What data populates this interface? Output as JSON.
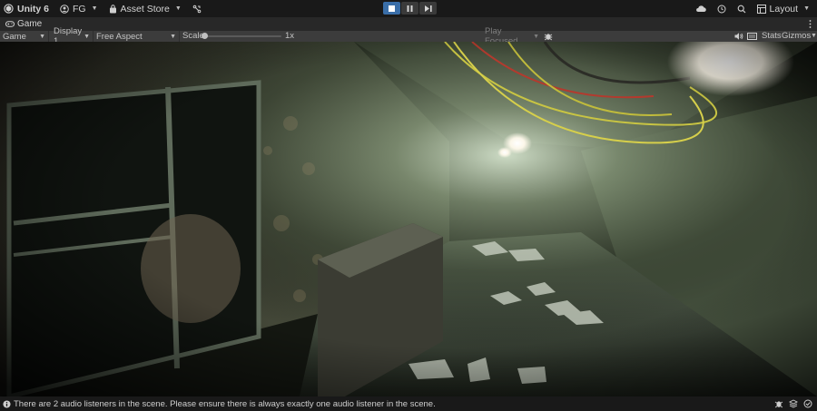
{
  "app": {
    "title": "Unity 6",
    "account": "FG",
    "asset_store": "Asset Store"
  },
  "tabs": [
    {
      "label": "Game"
    }
  ],
  "game_toolbar": {
    "view_mode": "Game",
    "display": "Display 1",
    "aspect": "Free Aspect",
    "scale_label": "Scale",
    "scale_value": "1x",
    "play_mode": "Play Focused",
    "stats": "Stats",
    "gizmos": "Gizmos"
  },
  "top_right": {
    "layout": "Layout"
  },
  "status": {
    "message": "There are 2 audio listeners in the scene. Please ensure there is always exactly one audio listener in the scene."
  },
  "icons": {
    "unity_logo": "unity-logo-icon",
    "account": "account-icon",
    "asset_store": "asset-store-icon",
    "version_control": "version-control-icon",
    "stop": "stop-icon",
    "pause": "pause-icon",
    "step": "step-icon",
    "cloud": "cloud-icon",
    "history": "history-icon",
    "search": "search-icon",
    "layout": "layout-icon",
    "game_tab": "gamepad-icon",
    "more": "more-vertical-icon",
    "bug": "bug-icon",
    "mute": "speaker-icon",
    "ratio": "aspect-icon",
    "info": "info-icon"
  },
  "colors": {
    "play_active": "#3a6ea8",
    "toolbar_bg": "#3c3c3c",
    "top_bg": "#191919"
  }
}
